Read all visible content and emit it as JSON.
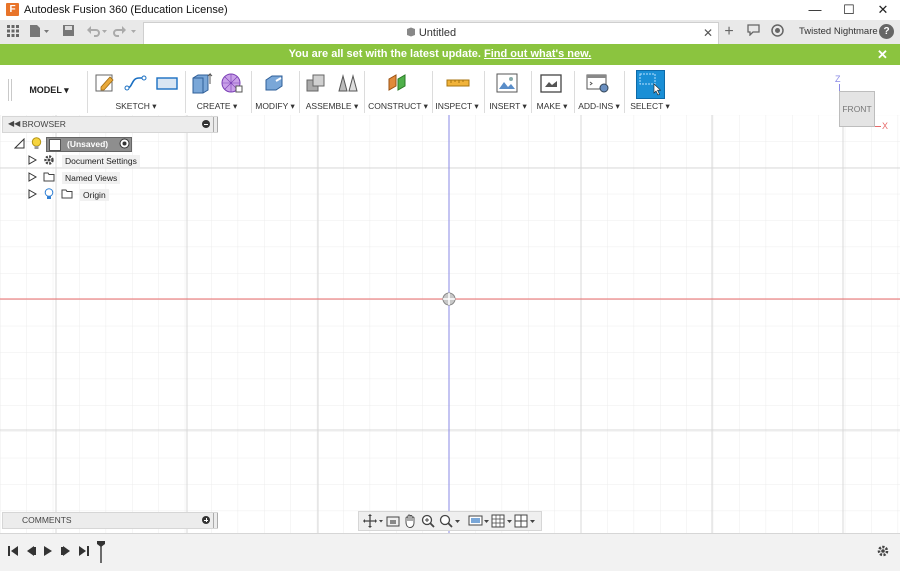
{
  "window": {
    "app_icon": "F",
    "title": "Autodesk Fusion 360 (Education License)",
    "minimize": "—",
    "maximize": "☐",
    "close": "✕"
  },
  "tabbar": {
    "doc_title": "Untitled",
    "doc_close": "✕",
    "new_tab": "+",
    "user_name": "Twisted Nightmare",
    "help": "?"
  },
  "banner": {
    "text": "You are all set with the latest update.",
    "link": "Find out what's new.",
    "close": "✕",
    "color": "#8bc43f"
  },
  "toolbar": {
    "workspace": "MODEL",
    "groups": [
      {
        "label": "SKETCH ▾"
      },
      {
        "label": "CREATE ▾"
      },
      {
        "label": "MODIFY ▾"
      },
      {
        "label": "ASSEMBLE ▾"
      },
      {
        "label": "CONSTRUCT ▾"
      },
      {
        "label": "INSPECT ▾"
      },
      {
        "label": "INSERT ▾"
      },
      {
        "label": "MAKE ▾"
      },
      {
        "label": "ADD-INS ▾"
      },
      {
        "label": "SELECT ▾"
      }
    ]
  },
  "browser": {
    "title": "BROWSER",
    "root": "(Unsaved)",
    "items": [
      {
        "label": "Document Settings"
      },
      {
        "label": "Named Views"
      },
      {
        "label": "Origin"
      }
    ]
  },
  "comments": {
    "title": "COMMENTS"
  },
  "viewcube": {
    "face": "FRONT",
    "axis_z": "Z",
    "axis_x": "X"
  },
  "colors": {
    "accent": "#1a8fd6",
    "x_axis": "#e86a6a",
    "z_axis": "#8a8ae6",
    "grid": "#e3e3e3"
  }
}
